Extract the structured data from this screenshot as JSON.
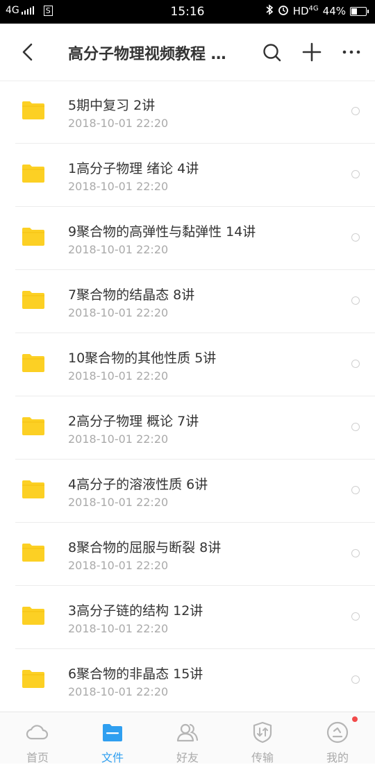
{
  "status_bar": {
    "network": "4G",
    "time": "15:16",
    "hd": "HD",
    "hd_network": "4G",
    "battery": "44%",
    "battery_level": 0.44
  },
  "header": {
    "title": "高分子物理视频教程 …"
  },
  "files": [
    {
      "name": "5期中复习  2讲",
      "date": "2018-10-01  22:20"
    },
    {
      "name": "1高分子物理 绪论  4讲",
      "date": "2018-10-01  22:20"
    },
    {
      "name": "9聚合物的高弹性与黏弹性  14讲",
      "date": "2018-10-01  22:20"
    },
    {
      "name": "7聚合物的结晶态  8讲",
      "date": "2018-10-01  22:20"
    },
    {
      "name": "10聚合物的其他性质  5讲",
      "date": "2018-10-01  22:20"
    },
    {
      "name": "2高分子物理 概论  7讲",
      "date": "2018-10-01  22:20"
    },
    {
      "name": "4高分子的溶液性质  6讲",
      "date": "2018-10-01  22:20"
    },
    {
      "name": "8聚合物的屈服与断裂  8讲",
      "date": "2018-10-01  22:20"
    },
    {
      "name": "3高分子链的结构  12讲",
      "date": "2018-10-01  22:20"
    },
    {
      "name": "6聚合物的非晶态  15讲",
      "date": "2018-10-01  22:20"
    }
  ],
  "nav": [
    {
      "label": "首页",
      "icon": "cloud-icon"
    },
    {
      "label": "文件",
      "icon": "folder-icon"
    },
    {
      "label": "好友",
      "icon": "friends-icon"
    },
    {
      "label": "传输",
      "icon": "transfer-icon"
    },
    {
      "label": "我的",
      "icon": "profile-icon"
    }
  ],
  "colors": {
    "accent": "#2f9ff0",
    "folder": "#fcd024",
    "badge": "#f24a4a"
  }
}
